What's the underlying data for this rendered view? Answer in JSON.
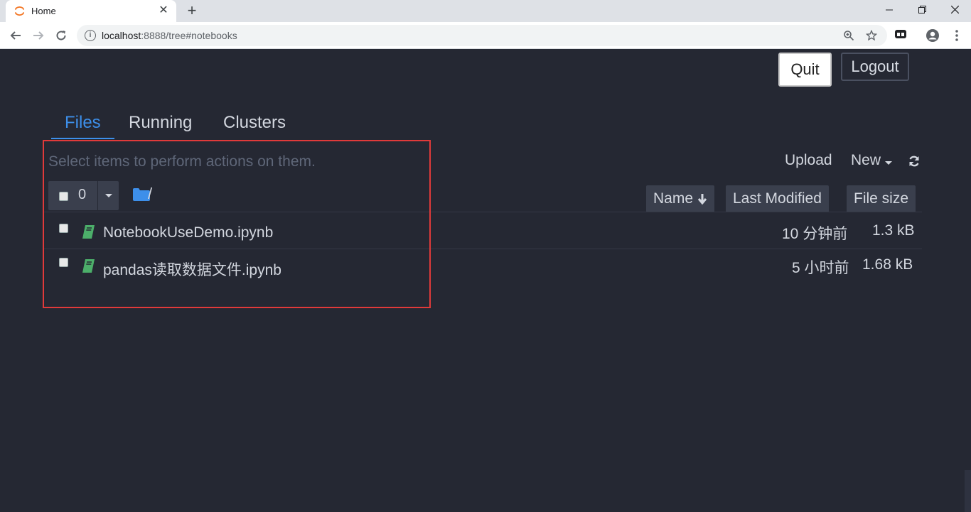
{
  "browser": {
    "tab_title": "Home",
    "url_host": "localhost",
    "url_rest": ":8888/tree#notebooks",
    "new_tab_symbol": "+",
    "close_symbol": "✕",
    "minimize_symbol": "—",
    "restore_symbol": "❐",
    "window_close_symbol": "✕"
  },
  "header": {
    "quit_label": "Quit",
    "logout_label": "Logout"
  },
  "tabs": [
    {
      "label": "Files",
      "active": true
    },
    {
      "label": "Running",
      "active": false
    },
    {
      "label": "Clusters",
      "active": false
    }
  ],
  "files": {
    "hint": "Select items to perform actions on them.",
    "selected_count": "0",
    "breadcrumb": "/",
    "upload_label": "Upload",
    "new_label": "New",
    "columns": {
      "name": "Name",
      "last_modified": "Last Modified",
      "file_size": "File size"
    },
    "sort_arrow": "🡣",
    "rows": [
      {
        "name": "NotebookUseDemo.ipynb",
        "modified": "10 分钟前",
        "size": "1.3 kB"
      },
      {
        "name": "pandas读取数据文件.ipynb",
        "modified": "5 小时前",
        "size": "1.68 kB"
      }
    ]
  },
  "colors": {
    "background": "#252833",
    "accent": "#3d8fea",
    "notebook_icon": "#4caf6a",
    "highlight": "#e03a3a"
  }
}
